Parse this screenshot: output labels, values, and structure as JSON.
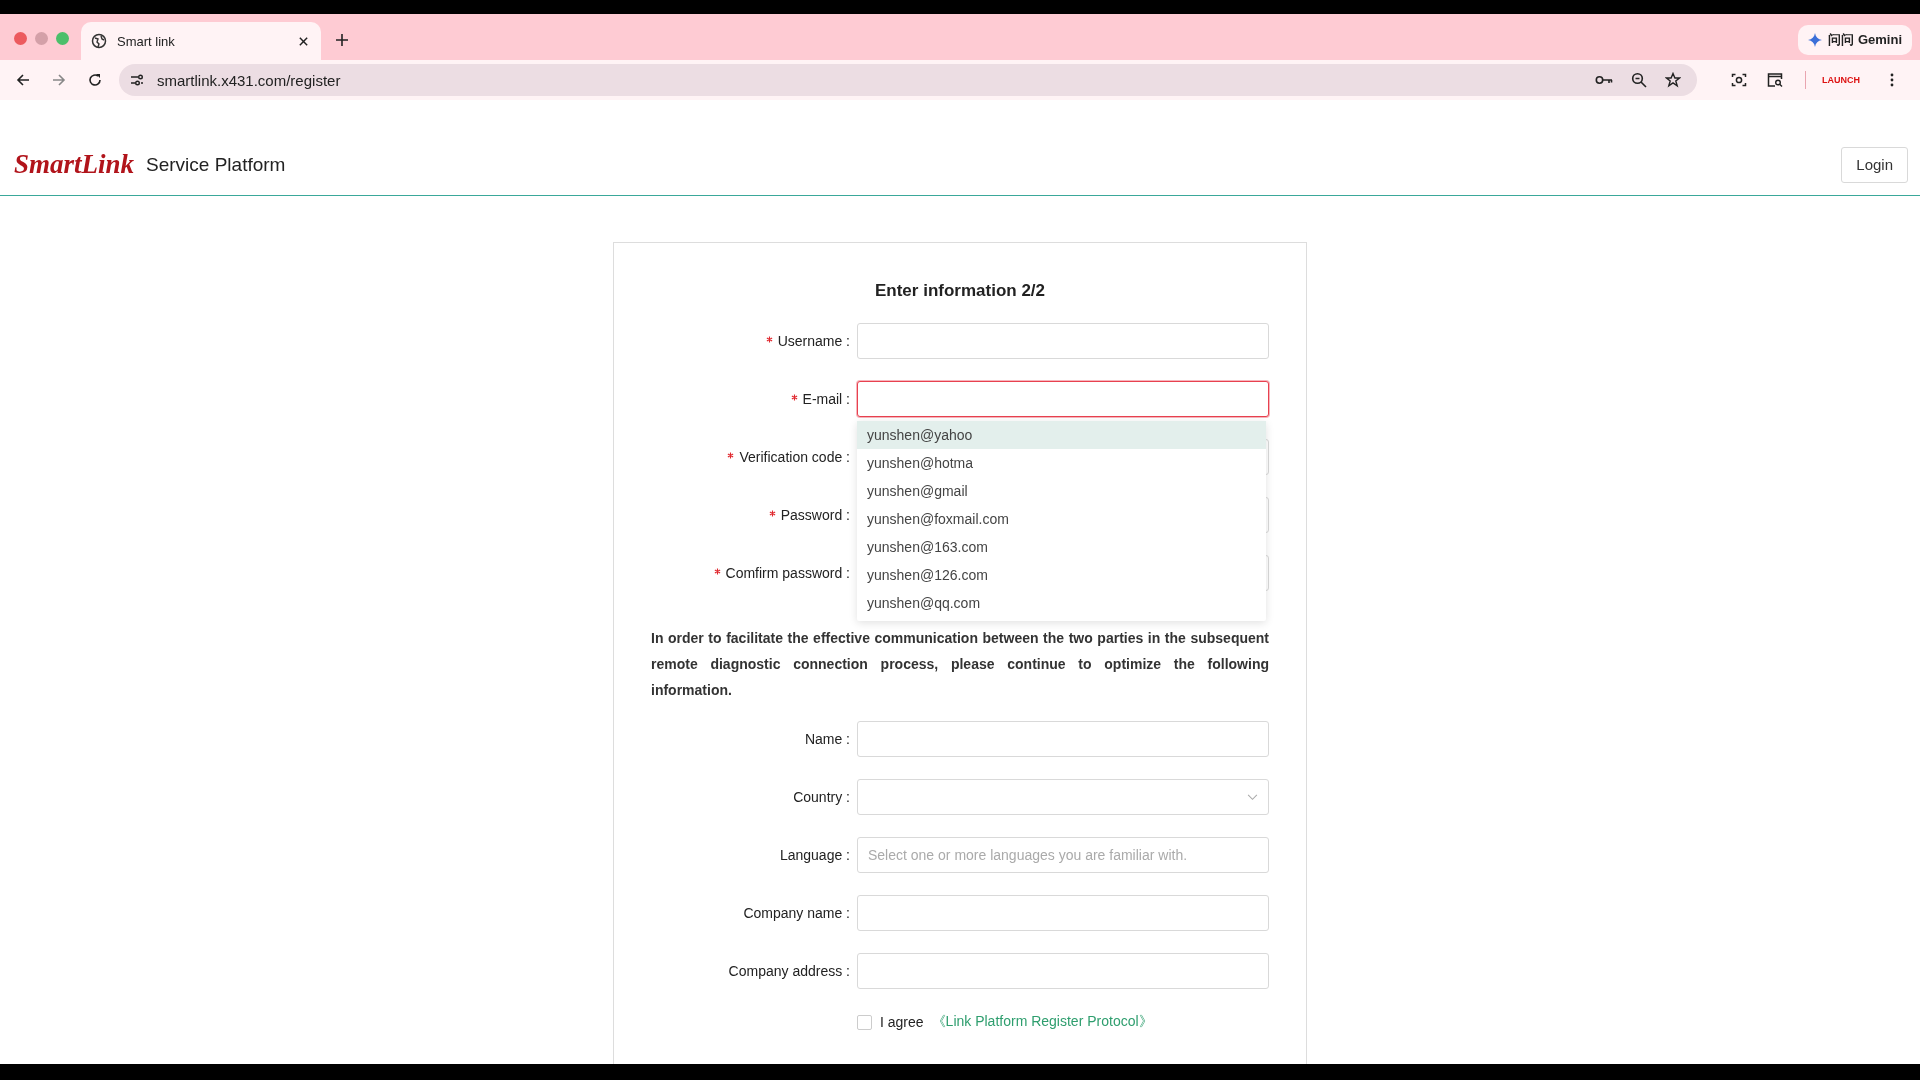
{
  "browser": {
    "tab": {
      "title": "Smart link"
    },
    "address": "smartlink.x431.com/register",
    "gemini_button": "问问 Gemini",
    "extension_label": "LAUNCH"
  },
  "header": {
    "logo": "SmartLink",
    "title": "Service Platform",
    "login_button": "Login"
  },
  "form": {
    "title": "Enter information 2/2",
    "required_fields": [
      {
        "kind": "input",
        "label": "Username :",
        "required": true,
        "error": false
      },
      {
        "kind": "input",
        "label": "E-mail :",
        "required": true,
        "error": true
      },
      {
        "kind": "input",
        "label": "Verification code :",
        "required": true,
        "error": false
      },
      {
        "kind": "input",
        "label": "Password :",
        "required": true,
        "error": false
      },
      {
        "kind": "input",
        "label": "Comfirm password :",
        "required": true,
        "error": false
      }
    ],
    "email_suggestions": [
      {
        "text": "yunshen@yahoo",
        "selected": true
      },
      {
        "text": "yunshen@hotma",
        "selected": false
      },
      {
        "text": "yunshen@gmail",
        "selected": false
      },
      {
        "text": "yunshen@foxmail.com",
        "selected": false
      },
      {
        "text": "yunshen@163.com",
        "selected": false
      },
      {
        "text": "yunshen@126.com",
        "selected": false
      },
      {
        "text": "yunshen@qq.com",
        "selected": false
      }
    ],
    "notice": "In order to facilitate the effective communication between the two parties in the subsequent remote diagnostic connection process, please continue to optimize the following information.",
    "optional_fields": [
      {
        "kind": "input",
        "label": "Name :",
        "required": false,
        "error": false
      },
      {
        "kind": "select",
        "label": "Country :",
        "required": false,
        "error": false
      },
      {
        "kind": "input",
        "label": "Language :",
        "required": false,
        "error": false,
        "placeholder": "Select one or more languages you are familiar with."
      },
      {
        "kind": "input",
        "label": "Company name :",
        "required": false,
        "error": false
      },
      {
        "kind": "input",
        "label": "Company address :",
        "required": false,
        "error": false
      }
    ],
    "agreement": {
      "checked": false,
      "label": "I agree",
      "link": "《Link Platform Register Protocol》"
    }
  }
}
